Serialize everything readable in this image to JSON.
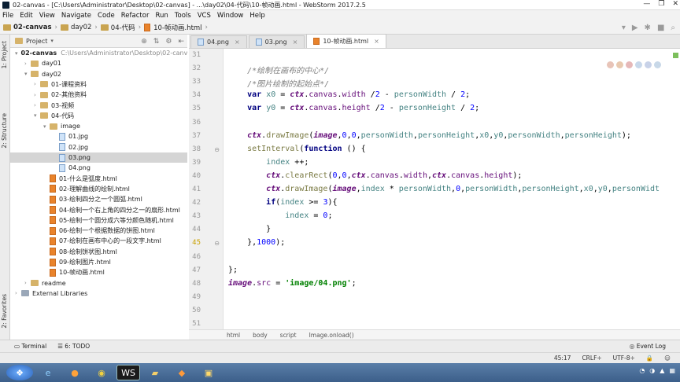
{
  "window": {
    "title": "02-canvas - [C:\\Users\\Administrator\\Desktop\\02-canvas] - ...\\day02\\04-代码\\10-帧动画.html - WebStorm 2017.2.5",
    "controls": [
      "—",
      "❐",
      "✕"
    ]
  },
  "menu": [
    "File",
    "Edit",
    "View",
    "Navigate",
    "Code",
    "Refactor",
    "Run",
    "Tools",
    "VCS",
    "Window",
    "Help"
  ],
  "breadcrumbs": [
    "02-canvas",
    "day02",
    "04-代码",
    "10-帧动画.html"
  ],
  "left_strip": {
    "project": "1: Project",
    "structure": "2: Structure",
    "favorites": "2: Favorites"
  },
  "project_panel": {
    "title": "Project"
  },
  "tree": [
    {
      "label": "02-canvas",
      "hint": "C:\\Users\\Administrator\\Desktop\\02-canvas",
      "kind": "folder",
      "indent": 0,
      "expanded": true
    },
    {
      "label": "day01",
      "kind": "folder",
      "indent": 1,
      "expanded": false
    },
    {
      "label": "day02",
      "kind": "folder",
      "indent": 1,
      "expanded": true
    },
    {
      "label": "01-课程资料",
      "kind": "folder",
      "indent": 2,
      "expanded": false
    },
    {
      "label": "02-其他资料",
      "kind": "folder",
      "indent": 2,
      "expanded": false
    },
    {
      "label": "03-视频",
      "kind": "folder",
      "indent": 2,
      "expanded": false
    },
    {
      "label": "04-代码",
      "kind": "folder",
      "indent": 2,
      "expanded": true
    },
    {
      "label": "image",
      "kind": "folder",
      "indent": 3,
      "expanded": true
    },
    {
      "label": "01.jpg",
      "kind": "image",
      "indent": 4
    },
    {
      "label": "02.jpg",
      "kind": "image",
      "indent": 4
    },
    {
      "label": "03.png",
      "kind": "image",
      "indent": 4,
      "selected": true
    },
    {
      "label": "04.png",
      "kind": "image",
      "indent": 4
    },
    {
      "label": "01-什么是弧度.html",
      "kind": "html",
      "indent": 3
    },
    {
      "label": "02-理解曲线的绘制.html",
      "kind": "html",
      "indent": 3
    },
    {
      "label": "03-绘制四分之一个圆弧.html",
      "kind": "html",
      "indent": 3
    },
    {
      "label": "04-绘制一个右上角的四分之一的扇形.html",
      "kind": "html",
      "indent": 3
    },
    {
      "label": "05-绘制一个圆分成六等分颜色随机.html",
      "kind": "html",
      "indent": 3
    },
    {
      "label": "06-绘制一个根据数据的饼图.html",
      "kind": "html",
      "indent": 3
    },
    {
      "label": "07-绘制在画布中心的一段文字.html",
      "kind": "html",
      "indent": 3
    },
    {
      "label": "08-绘制饼状图.html",
      "kind": "html",
      "indent": 3
    },
    {
      "label": "09-绘制图片.html",
      "kind": "html",
      "indent": 3
    },
    {
      "label": "10-帧动画.html",
      "kind": "html",
      "indent": 3
    },
    {
      "label": "readme",
      "kind": "folder",
      "indent": 1,
      "expanded": false
    },
    {
      "label": "External Libraries",
      "kind": "lib",
      "indent": 0,
      "expanded": false
    }
  ],
  "tabs": [
    {
      "label": "04.png",
      "active": false
    },
    {
      "label": "03.png",
      "active": false
    },
    {
      "label": "10-帧动画.html",
      "active": true
    }
  ],
  "code_lines": [
    {
      "n": "31",
      "html": ""
    },
    {
      "n": "32",
      "html": "    <span class=\"cm\">/*绘制在画布的中心*/</span>"
    },
    {
      "n": "33",
      "html": "    <span class=\"cm\">/*图片绘制的起始点*/</span>"
    },
    {
      "n": "34",
      "html": "    <span class=\"kw\">var</span> <span class=\"lv\">x0</span> = <span class=\"it\">ctx</span>.<span class=\"pu\">canvas</span>.<span class=\"pu\">width</span> /<span class=\"nu\">2</span> - <span class=\"lv\">personWidth</span> / <span class=\"nu\">2</span>;"
    },
    {
      "n": "35",
      "html": "    <span class=\"kw\">var</span> <span class=\"lv\">y0</span> = <span class=\"it\">ctx</span>.<span class=\"pu\">canvas</span>.<span class=\"pu\">height</span> /<span class=\"nu\">2</span> - <span class=\"lv\">personHeight</span> / <span class=\"nu\">2</span>;"
    },
    {
      "n": "36",
      "html": ""
    },
    {
      "n": "37",
      "html": "    <span class=\"it\">ctx</span>.<span class=\"fn\">drawImage</span>(<span class=\"it\">image</span>,<span class=\"nu\">0</span>,<span class=\"nu\">0</span>,<span class=\"lv\">personWidth</span>,<span class=\"lv\">personHeight</span>,<span class=\"lv\">x0</span>,<span class=\"lv\">y0</span>,<span class=\"lv\">personWidth</span>,<span class=\"lv\">personHeight</span>);"
    },
    {
      "n": "38",
      "html": "    <span class=\"fn\">setInterval</span>(<span class=\"kw\">function</span> () {"
    },
    {
      "n": "39",
      "html": "        <span class=\"lv\">index</span> ++;"
    },
    {
      "n": "40",
      "html": "        <span class=\"it\">ctx</span>.<span class=\"fn\">clearRect</span>(<span class=\"nu\">0</span>,<span class=\"nu\">0</span>,<span class=\"it\">ctx</span>.<span class=\"pu\">canvas</span>.<span class=\"pu\">width</span>,<span class=\"it\">ctx</span>.<span class=\"pu\">canvas</span>.<span class=\"pu\">height</span>);"
    },
    {
      "n": "41",
      "html": "        <span class=\"it\">ctx</span>.<span class=\"fn\">drawImage</span>(<span class=\"it\">image</span>,<span class=\"lv\">index</span> * <span class=\"lv\">personWidth</span>,<span class=\"nu\">0</span>,<span class=\"lv\">personWidth</span>,<span class=\"lv\">personHeight</span>,<span class=\"lv\">x0</span>,<span class=\"lv\">y0</span>,<span class=\"lv\">personWidt</span>"
    },
    {
      "n": "42",
      "html": "        <span class=\"kw\">if</span>(<span class=\"lv\">index</span> >= <span class=\"nu\">3</span>){"
    },
    {
      "n": "43",
      "html": "            <span class=\"lv\">index</span> = <span class=\"nu\">0</span>;"
    },
    {
      "n": "44",
      "html": "        }"
    },
    {
      "n": "45",
      "html": "    },<span class=\"nu\">1000</span>);"
    },
    {
      "n": "46",
      "html": ""
    },
    {
      "n": "47",
      "html": "};"
    },
    {
      "n": "48",
      "html": "<span class=\"it\">image</span>.<span class=\"pu\">src</span> = <span class=\"st\">'image/04.png'</span>;"
    },
    {
      "n": "49",
      "html": ""
    },
    {
      "n": "50",
      "html": ""
    },
    {
      "n": "51",
      "html": ""
    }
  ],
  "code_breadcrumb": [
    "html",
    "body",
    "script",
    "Image.onload()"
  ],
  "bottom_tools": {
    "terminal": "Terminal",
    "todo": "6: TODO",
    "event_log": "Event Log"
  },
  "status": {
    "position": "45:17",
    "line_sep": "CRLF÷",
    "encoding": "UTF-8÷"
  }
}
